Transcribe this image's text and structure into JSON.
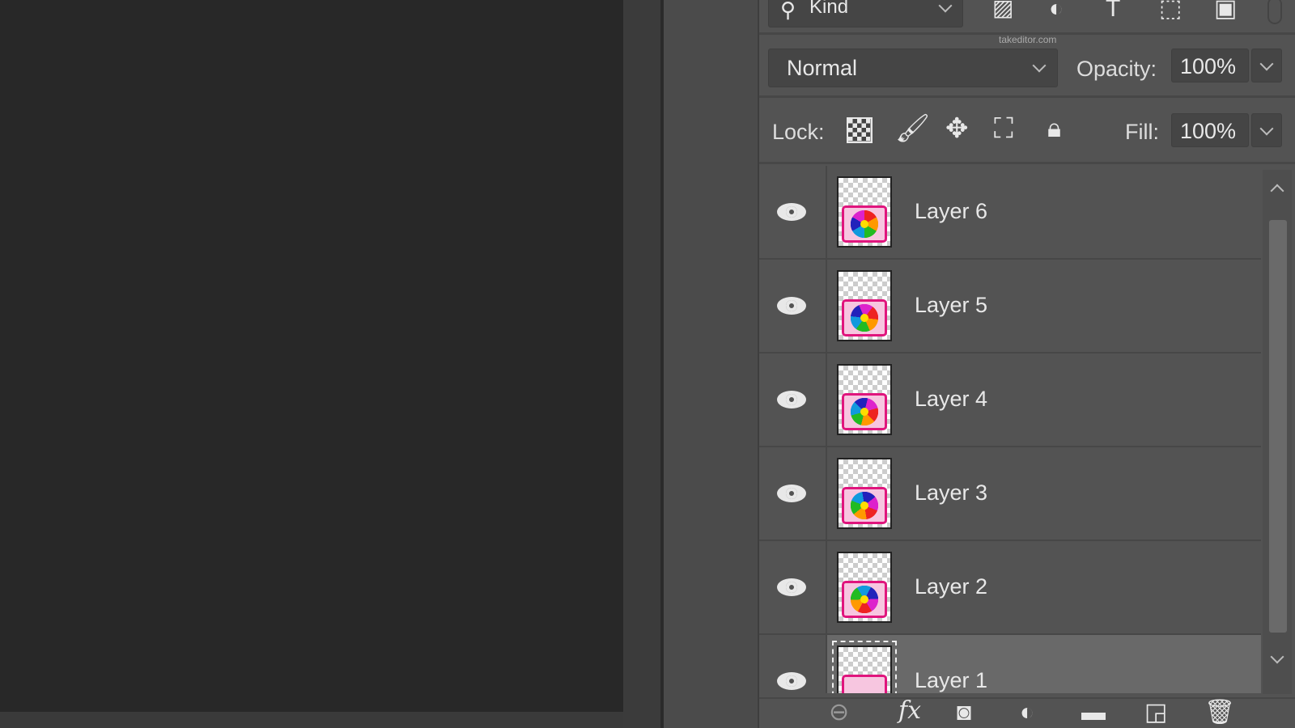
{
  "filter": {
    "kind_label": "Kind"
  },
  "watermark": "takeditor.com",
  "blend": {
    "mode": "Normal",
    "opacity_label": "Opacity:",
    "opacity": "100%"
  },
  "lock": {
    "label": "Lock:",
    "fill_label": "Fill:",
    "fill": "100%"
  },
  "layers": [
    {
      "name": "Layer 6",
      "visible": true,
      "selected": false
    },
    {
      "name": "Layer 5",
      "visible": true,
      "selected": false
    },
    {
      "name": "Layer 4",
      "visible": true,
      "selected": false
    },
    {
      "name": "Layer 3",
      "visible": true,
      "selected": false
    },
    {
      "name": "Layer 2",
      "visible": true,
      "selected": false
    },
    {
      "name": "Layer 1",
      "visible": true,
      "selected": true
    }
  ],
  "bottom": {
    "fx_label": "fx"
  },
  "colors": {
    "panel": "#535353",
    "selected": "#696969",
    "frame": "#e0157d"
  }
}
